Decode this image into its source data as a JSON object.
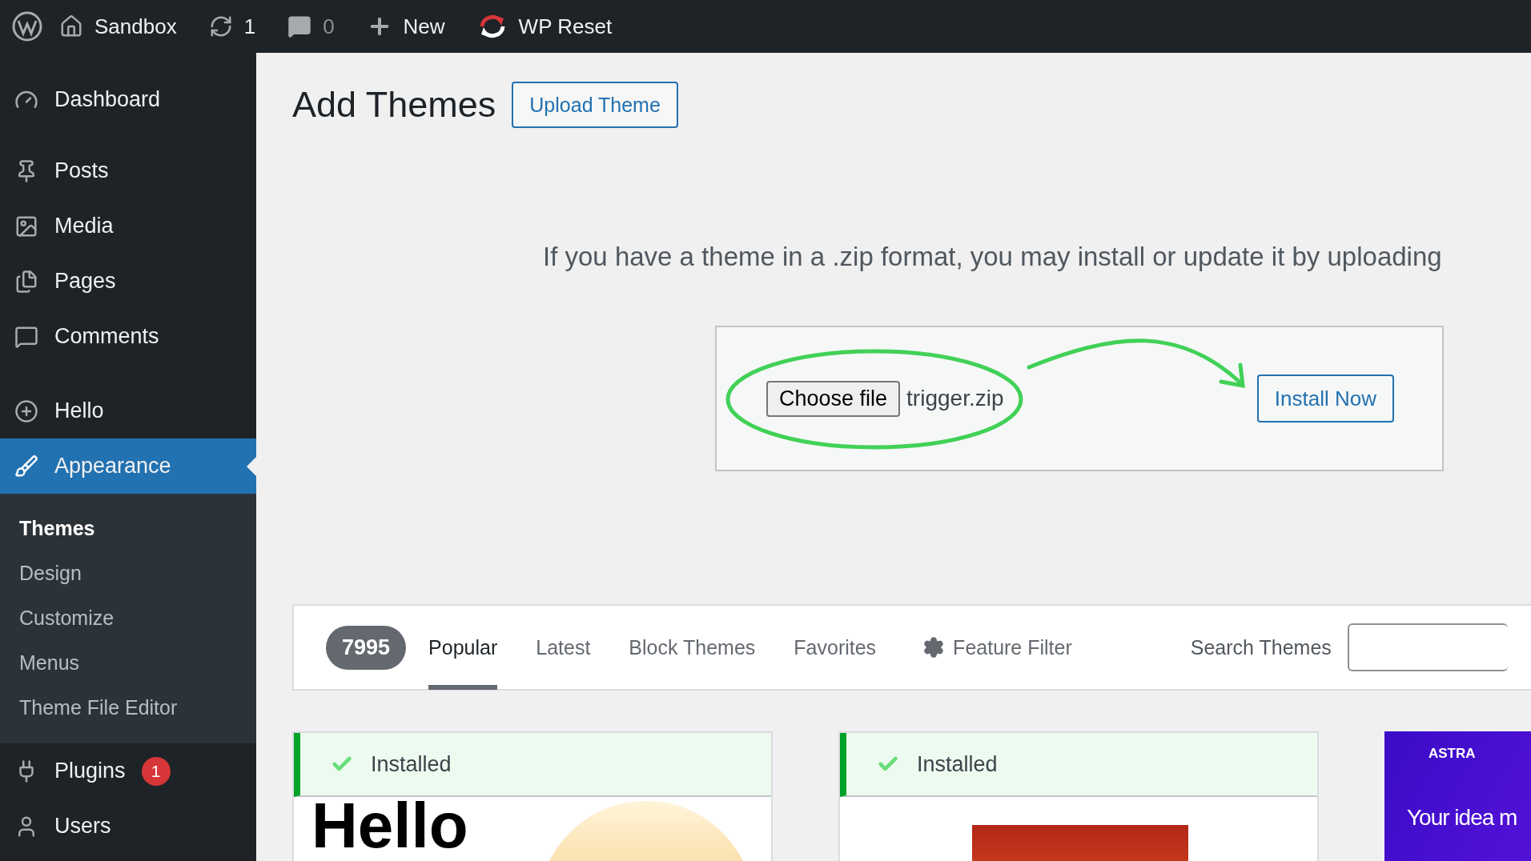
{
  "admin_bar": {
    "items": [
      {
        "kind": "site",
        "label": "Sandbox"
      },
      {
        "kind": "updates",
        "label": "1"
      },
      {
        "kind": "comments",
        "label": "0"
      },
      {
        "kind": "new",
        "label": "New"
      },
      {
        "kind": "reset",
        "label": "WP Reset"
      }
    ]
  },
  "sidebar": {
    "items": [
      {
        "kind": "dashboard",
        "label": "Dashboard",
        "selected": false
      },
      {
        "kind": "posts",
        "label": "Posts",
        "selected": false
      },
      {
        "kind": "media",
        "label": "Media",
        "selected": false
      },
      {
        "kind": "pages",
        "label": "Pages",
        "selected": false
      },
      {
        "kind": "comments",
        "label": "Comments",
        "selected": false
      },
      {
        "kind": "hello",
        "label": "Hello",
        "selected": false
      },
      {
        "kind": "appearance",
        "label": "Appearance",
        "selected": true,
        "children": [
          {
            "label": "Themes",
            "selected": true
          },
          {
            "label": "Design",
            "selected": false
          },
          {
            "label": "Customize",
            "selected": false
          },
          {
            "label": "Menus",
            "selected": false
          },
          {
            "label": "Theme File Editor",
            "selected": false
          }
        ]
      },
      {
        "kind": "plugins",
        "label": "Plugins",
        "selected": false,
        "badge": "1"
      },
      {
        "kind": "users",
        "label": "Users",
        "selected": false
      }
    ]
  },
  "header": {
    "title": "Add Themes",
    "button": "Upload Theme"
  },
  "upload": {
    "description": "If you have a theme in a .zip format, you may install or update it by uploading",
    "choose_button": "Choose file",
    "file_name": "trigger.zip",
    "install_button": "Install Now"
  },
  "filter_bar": {
    "count": "7995",
    "tabs": [
      {
        "label": "Popular",
        "selected": true
      },
      {
        "label": "Latest",
        "selected": false
      },
      {
        "label": "Block Themes",
        "selected": false
      },
      {
        "label": "Favorites",
        "selected": false
      }
    ],
    "feature_filter": "Feature Filter",
    "search_label": "Search Themes"
  },
  "themes": [
    {
      "kind": "hello",
      "installed": true,
      "status": "Installed",
      "thumb_title": "Hello"
    },
    {
      "kind": "blog",
      "installed": true,
      "status": "Installed"
    },
    {
      "kind": "astra",
      "installed": false,
      "brand": "ASTRA",
      "thumb_title": "Your idea m"
    }
  ]
}
